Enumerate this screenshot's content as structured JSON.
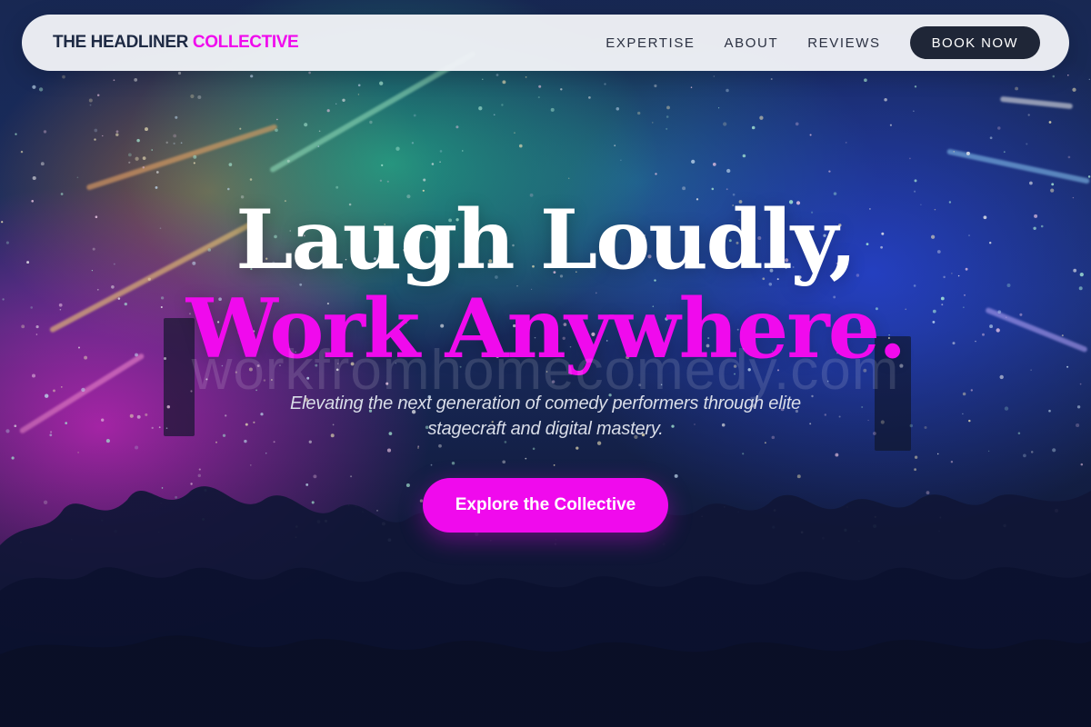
{
  "brand": {
    "name_primary": "THE HEADLINER",
    "name_accent": "COLLECTIVE"
  },
  "nav": {
    "links": [
      "EXPERTISE",
      "ABOUT",
      "REVIEWS"
    ],
    "cta_label": "BOOK NOW"
  },
  "hero": {
    "headline_line1": "Laugh Loudly,",
    "headline_line2": "Work Anywhere.",
    "watermark": "workfromhomecomedy.com",
    "subtitle": "Elevating the next generation of comedy performers through elite stagecraft and digital mastery.",
    "cta_label": "Explore the Collective"
  },
  "colors": {
    "accent": "#f00aed",
    "nav_background": "#f0f3f7",
    "nav_cta_background": "#1f2637",
    "brand_dark": "#1e2a44"
  }
}
